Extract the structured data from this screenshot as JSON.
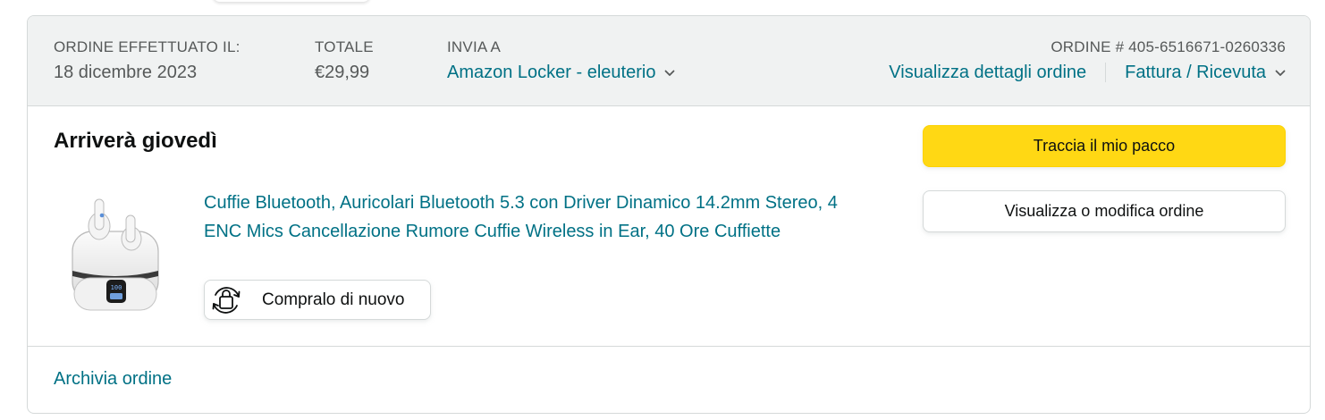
{
  "header": {
    "order_placed_label": "ORDINE EFFETTUATO IL:",
    "order_date": "18 dicembre 2023",
    "total_label": "TOTALE",
    "total_value": "€29,99",
    "ship_to_label": "INVIA A",
    "ship_to_value": "Amazon Locker - eleuterio",
    "order_number": "ORDINE # 405-6516671-0260336",
    "view_details_link": "Visualizza dettagli ordine",
    "invoice_link": "Fattura / Ricevuta",
    "chevron_icon": "chevron-down-icon"
  },
  "shipment": {
    "delivery_status": "Arriverà giovedì",
    "product": {
      "title": "Cuffie Bluetooth, Auricolari Bluetooth 5.3 con Driver Dinamico 14.2mm Stereo, 4 ENC Mics Cancellazione Rumore Cuffie Wireless in Ear, 40 Ore Cuffiette",
      "image_icon": "earbuds-product-image",
      "battery_display": "100"
    },
    "buy_again_label": "Compralo di nuovo",
    "buy_again_icon": "buy-again-icon"
  },
  "actions": {
    "track_package": "Traccia il mio pacco",
    "view_edit_order": "Visualizza o modifica ordine"
  },
  "footer": {
    "archive_order": "Archivia ordine"
  },
  "colors": {
    "link": "#007185",
    "primary_button": "#FFD814",
    "header_bg": "#F0F2F2",
    "border": "#D5D9D9"
  }
}
